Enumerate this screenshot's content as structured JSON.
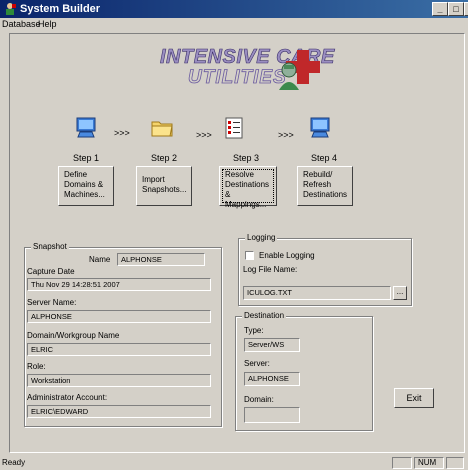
{
  "window": {
    "title": "System Builder"
  },
  "menu": {
    "items": [
      "Database",
      "Help"
    ]
  },
  "logo": {
    "line1": "INTENSIVE CARE",
    "line2": "UTILITIES"
  },
  "steps": [
    {
      "label": "Step 1",
      "button": "Define Domains & Machines..."
    },
    {
      "label": "Step 2",
      "button": "Import Snapshots..."
    },
    {
      "label": "Step 3",
      "button": "Resolve Destinations & Mappings..."
    },
    {
      "label": "Step 4",
      "button": "Rebuild/ Refresh Destinations"
    }
  ],
  "separator": ">>>",
  "snapshot": {
    "legend": "Snapshot",
    "name_label": "Name",
    "name_value": "ALPHONSE",
    "capture_label": "Capture Date",
    "capture_value": "Thu Nov 29 14:28:51 2007",
    "server_label": "Server Name:",
    "server_value": "ALPHONSE",
    "domain_label": "Domain/Workgroup Name",
    "domain_value": "ELRIC",
    "role_label": "Role:",
    "role_value": "Workstation",
    "admin_label": "Administrator Account:",
    "admin_value": "ELRIC\\EDWARD"
  },
  "logging": {
    "legend": "Logging",
    "enable_label": "Enable Logging",
    "enable_checked": false,
    "file_label": "Log File Name:",
    "file_value": "ICULOG.TXT",
    "browse_label": "..."
  },
  "destination": {
    "legend": "Destination",
    "type_label": "Type:",
    "type_value": "Server/WS",
    "server_label": "Server:",
    "server_value": "ALPHONSE",
    "domain_label": "Domain:",
    "domain_value": ""
  },
  "exit_label": "Exit",
  "status": {
    "text": "Ready",
    "num": "NUM"
  }
}
